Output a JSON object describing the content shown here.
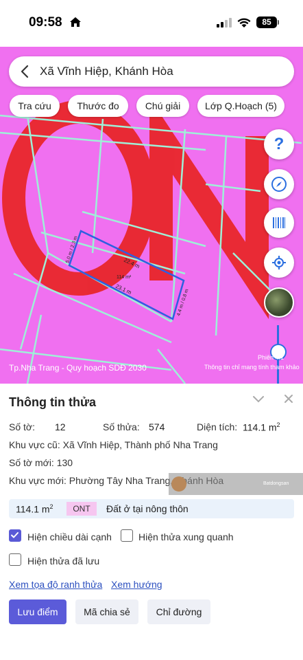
{
  "status_bar": {
    "time": "09:58",
    "battery": "85"
  },
  "map": {
    "search_text": "Xã Vĩnh Hiệp, Khánh Hòa",
    "chips": [
      "Tra cứu",
      "Thước đo",
      "Chú giải",
      "Lớp Q.Hoạch (5)"
    ],
    "caption": "Tp.Nha Trang - Quy hoạch SDĐ 2030",
    "phien_label": "Phiên",
    "version_label": "4.1",
    "note": "Thông tin chỉ mang tính tham khảo",
    "parcel_area_label": "114 m²",
    "dim_top": "22.4 m",
    "dim_bottom": "23.1 m",
    "dim_left": "5.0 m / 2.3 m",
    "dim_right": "4.4 m / 0.8 m",
    "help_glyph": "?",
    "accent_color": "#2b6fe0",
    "map_color": "#f070f0"
  },
  "panel": {
    "title": "Thông tin thửa",
    "so_to_label": "Số tờ:",
    "so_to_value": "12",
    "so_thua_label": "Số thửa:",
    "so_thua_value": "574",
    "dien_tich_label": "Diện tích:",
    "dien_tich_value": "114.1 m",
    "dien_tich_sup": "2",
    "khu_vuc_cu": "Khu vực cũ: Xã Vĩnh Hiệp, Thành phố Nha Trang",
    "so_to_moi": "Số tờ mới: 130",
    "khu_vuc_moi": "Khu vực mới: Phường Tây Nha Trang, Khánh Hòa",
    "watermark_text": "Batdongsan",
    "land_area": "114.1 m",
    "land_area_sup": "2",
    "land_code": "ONT",
    "land_type": "Đất ở tại nông thôn",
    "checkboxes": [
      {
        "label": "Hiện chiều dài cạnh",
        "checked": true
      },
      {
        "label": "Hiện thửa xung quanh",
        "checked": false
      },
      {
        "label": "Hiện thửa đã lưu",
        "checked": false
      }
    ],
    "link_coords": "Xem tọa độ ranh thửa",
    "link_direction": "Xem hướng",
    "btn_save": "Lưu điểm",
    "btn_share": "Mã chia sẻ",
    "btn_route": "Chỉ đường"
  }
}
